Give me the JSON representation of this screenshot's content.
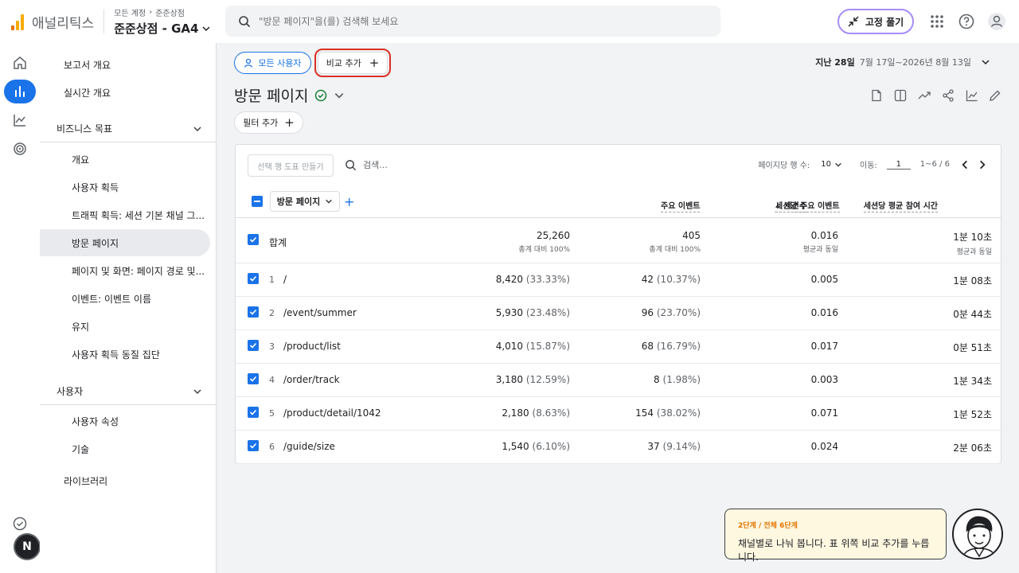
{
  "header": {
    "app_title": "애널리틱스",
    "crumb_account": "모든 계정",
    "crumb_property": "준준상점",
    "property_name": "준준상점 - GA4",
    "search_placeholder": "\"방문 페이지\"을(를) 검색해 보세요",
    "pin_label": "고정 풀기"
  },
  "nav": {
    "report_overview": "보고서 개요",
    "realtime_overview": "실시간 개요",
    "business_goals": "비즈니스 목표",
    "items": [
      "개요",
      "사용자 획득",
      "트래픽 획득: 세션 기본 채널 그...",
      "방문 페이지",
      "페이지 및 화면: 페이지 경로 및...",
      "이벤트: 이벤트 이름",
      "유지",
      "사용자 획득 동질 집단"
    ],
    "users_group": "사용자",
    "users_items": [
      "사용자 속성",
      "기술"
    ],
    "library": "라이브러리"
  },
  "main": {
    "all_users": "모든 사용자",
    "add_compare": "비교 추가",
    "date_label": "지난 28일",
    "date_range": "7월 17일~2026년 8월 13일",
    "page_title": "방문 페이지",
    "add_filter": "필터 추가"
  },
  "table": {
    "make_chart": "선택 행 도표 만들기",
    "search_placeholder": "검색...",
    "rows_per_page_label": "페이지당 행 수:",
    "rows_per_page": "10",
    "goto_label": "이동:",
    "page": "1",
    "range": "1~6 / 6",
    "dimension": "방문 페이지",
    "columns": [
      "세션수",
      "주요 이벤트",
      "세션당 주요 이벤트",
      "세션당 평균 참여 시간"
    ],
    "total": {
      "label": "합계",
      "sessions": "25,260",
      "sessions_sub": "총계 대비 100%",
      "events": "405",
      "events_sub": "총계 대비 100%",
      "events_per": "0.016",
      "events_per_sub": "평균과 동일",
      "time": "1분 10초",
      "time_sub": "평균과 동일"
    },
    "rows": [
      {
        "idx": "1",
        "path": "/",
        "sessions": "8,420",
        "sessions_pct": "(33.33%)",
        "events": "42",
        "events_pct": "(10.37%)",
        "events_per": "0.005",
        "time": "1분 08초"
      },
      {
        "idx": "2",
        "path": "/event/summer",
        "sessions": "5,930",
        "sessions_pct": "(23.48%)",
        "events": "96",
        "events_pct": "(23.70%)",
        "events_per": "0.016",
        "time": "0분 44초"
      },
      {
        "idx": "3",
        "path": "/product/list",
        "sessions": "4,010",
        "sessions_pct": "(15.87%)",
        "events": "68",
        "events_pct": "(16.79%)",
        "events_per": "0.017",
        "time": "0분 51초"
      },
      {
        "idx": "4",
        "path": "/order/track",
        "sessions": "3,180",
        "sessions_pct": "(12.59%)",
        "events": "8",
        "events_pct": "(1.98%)",
        "events_per": "0.003",
        "time": "1분 34초"
      },
      {
        "idx": "5",
        "path": "/product/detail/1042",
        "sessions": "2,180",
        "sessions_pct": "(8.63%)",
        "events": "154",
        "events_pct": "(38.02%)",
        "events_per": "0.071",
        "time": "1분 52초"
      },
      {
        "idx": "6",
        "path": "/guide/size",
        "sessions": "1,540",
        "sessions_pct": "(6.10%)",
        "events": "37",
        "events_pct": "(9.14%)",
        "events_per": "0.024",
        "time": "2분 06초"
      }
    ]
  },
  "tour": {
    "step": "2단계 / 전체 6단계",
    "message": "채널별로 나눠 봅니다. 표 위쪽 비교 추가를 누릅니다."
  },
  "rail": {
    "avatar_letter": "N"
  },
  "colors": {
    "accent": "#1a73e8",
    "highlight": "#d93025",
    "tour_bg": "#fff8e1",
    "logo_orange": "#f9ab00"
  }
}
